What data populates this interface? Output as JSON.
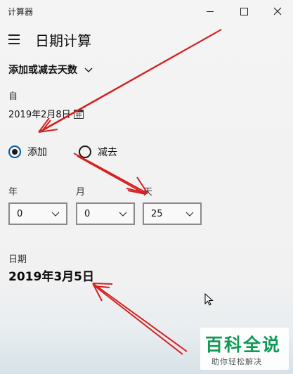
{
  "window": {
    "title": "计算器"
  },
  "header": {
    "title": "日期计算"
  },
  "mode": {
    "label": "添加或减去天数"
  },
  "from": {
    "label": "自",
    "date": "2019年2月8日"
  },
  "operation": {
    "add_label": "添加",
    "subtract_label": "减去",
    "selected": "add"
  },
  "units": {
    "years": {
      "label": "年",
      "value": "0"
    },
    "months": {
      "label": "月",
      "value": "0"
    },
    "days": {
      "label": "天",
      "value": "25"
    }
  },
  "result": {
    "label": "日期",
    "value": "2019年3月5日"
  },
  "watermark": {
    "logo_text": "百科全说",
    "sub_text": "助你轻松解决"
  },
  "colors": {
    "annotation_arrow": "#d42020",
    "radio_accent": "#005a9e",
    "watermark_green": "#119955"
  }
}
